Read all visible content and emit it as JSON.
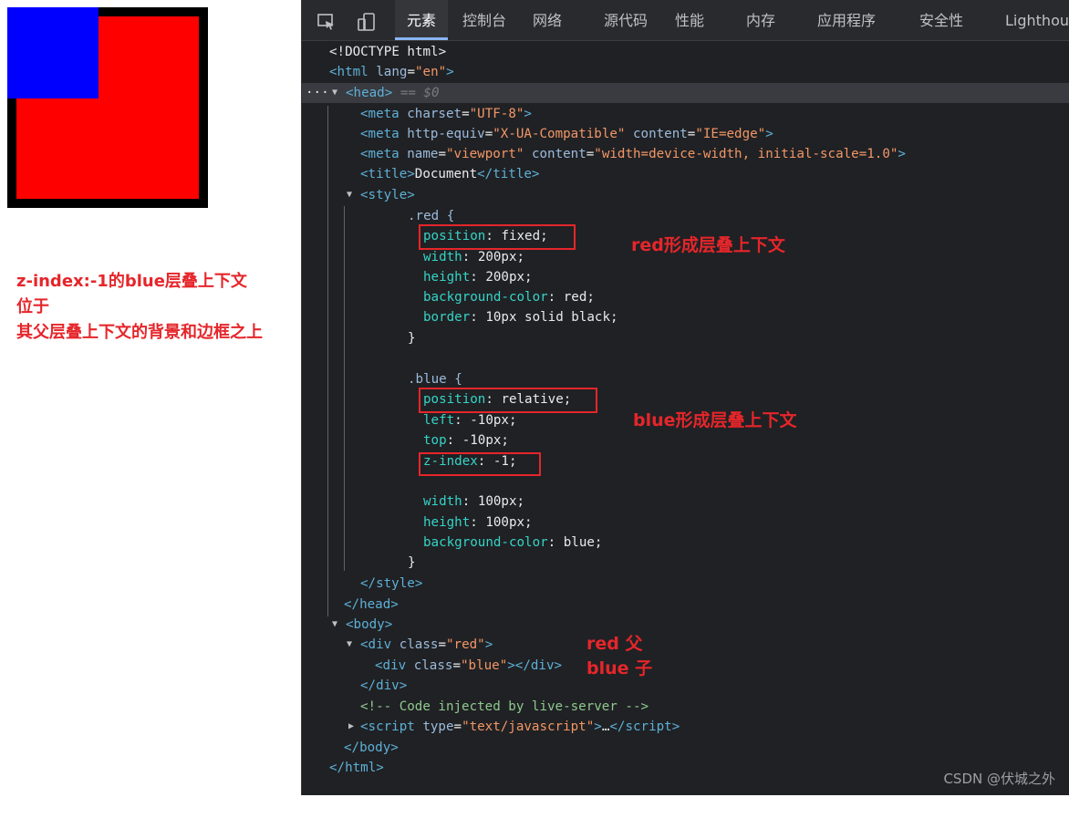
{
  "preview": {
    "colors": {
      "red": "#ff0000",
      "blue": "#0000ff",
      "border": "#000000"
    },
    "note_lines": [
      "z-index:-1的blue层叠上下文",
      "位于",
      "其父层叠上下文的背景和边框之上"
    ]
  },
  "devtools": {
    "toolbar_icons": [
      "inspect-element-icon",
      "device-toolbar-icon"
    ],
    "tabs": [
      {
        "label": "元素",
        "active": true
      },
      {
        "label": "控制台"
      },
      {
        "label": "网络"
      },
      {
        "label": "源代码"
      },
      {
        "label": "性能"
      },
      {
        "label": "内存"
      },
      {
        "label": "应用程序"
      },
      {
        "label": "安全性"
      },
      {
        "label": "Lighthouse"
      }
    ],
    "code": {
      "doctype": "<!DOCTYPE html>",
      "html_tag": "html",
      "html_attr": "lang",
      "html_val": "\"en\"",
      "head_tag": "head",
      "head_hint": "== $0",
      "meta1_attr": "charset",
      "meta1_val": "\"UTF-8\"",
      "meta2_attr1": "http-equiv",
      "meta2_val1": "\"X-UA-Compatible\"",
      "meta2_attr2": "content",
      "meta2_val2": "\"IE=edge\"",
      "meta3_attr1": "name",
      "meta3_val1": "\"viewport\"",
      "meta3_attr2": "content",
      "meta3_val2": "\"width=device-width, initial-scale=1.0\"",
      "title_text": "Document",
      "style_tag": "style",
      "red_selector": ".red {",
      "red_rules": [
        {
          "prop": "position",
          "value": "fixed;"
        },
        {
          "prop": "width",
          "value": "200px;"
        },
        {
          "prop": "height",
          "value": "200px;"
        },
        {
          "prop": "background-color",
          "value": "red;"
        },
        {
          "prop": "border",
          "value": "10px solid black;"
        }
      ],
      "close_brace": "}",
      "blue_selector": ".blue {",
      "blue_rules": [
        {
          "prop": "position",
          "value": "relative;"
        },
        {
          "prop": "left",
          "value": "-10px;"
        },
        {
          "prop": "top",
          "value": "-10px;"
        },
        {
          "prop": "z-index",
          "value": "-1;"
        },
        {
          "prop": "width",
          "value": "100px;"
        },
        {
          "prop": "height",
          "value": "100px;"
        },
        {
          "prop": "background-color",
          "value": "blue;"
        }
      ],
      "body_tag": "body",
      "div_red_attr": "class",
      "div_red_val": "\"red\"",
      "div_blue_attr": "class",
      "div_blue_val": "\"blue\"",
      "comment": "<!-- Code injected by live-server -->",
      "script_attr": "type",
      "script_val": "\"text/javascript\"",
      "script_ellipsis": "…"
    },
    "annotations": {
      "red_context": "red形成层叠上下文",
      "blue_context": "blue形成层叠上下文",
      "red_parent": "red 父",
      "blue_child": "blue 子"
    },
    "watermark": "CSDN @伏城之外"
  }
}
